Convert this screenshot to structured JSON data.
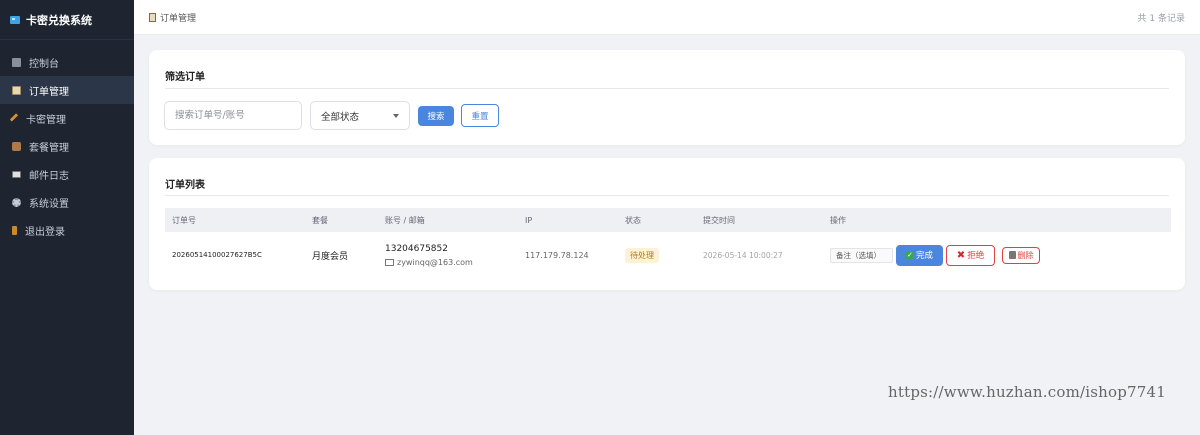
{
  "app": {
    "title": "卡密兑换系统"
  },
  "sidebar": {
    "items": [
      {
        "label": "控制台",
        "icon": "dashboard-icon"
      },
      {
        "label": "订单管理",
        "icon": "clipboard-icon",
        "active": true
      },
      {
        "label": "卡密管理",
        "icon": "key-icon"
      },
      {
        "label": "套餐管理",
        "icon": "package-icon"
      },
      {
        "label": "邮件日志",
        "icon": "mail-icon"
      },
      {
        "label": "系统设置",
        "icon": "gear-icon"
      },
      {
        "label": "退出登录",
        "icon": "exit-icon"
      }
    ]
  },
  "header": {
    "breadcrumb": "订单管理",
    "record_count": "共 1 条记录"
  },
  "filter": {
    "title": "筛选订单",
    "search_placeholder": "搜索订单号/账号",
    "status_selected": "全部状态",
    "search_label": "搜索",
    "reset_label": "重置"
  },
  "orders": {
    "title": "订单列表",
    "columns": [
      "订单号",
      "套餐",
      "账号 / 邮箱",
      "IP",
      "状态",
      "提交时间",
      "操作"
    ],
    "rows": [
      {
        "order_no": "20260514100027627B5C",
        "package": "月度会员",
        "phone": "13204675852",
        "email": "zywinqq@163.com",
        "ip": "117.179.78.124",
        "status": "待处理",
        "submit_time": "2026-05-14 10:00:27",
        "remark_placeholder": "备注（选填）",
        "done_label": "完成",
        "reject_label": "拒绝",
        "delete_label": "删除"
      }
    ]
  },
  "watermark": "https://www.huzhan.com/ishop7741",
  "colors": {
    "sidebar_bg": "#1e2430",
    "primary": "#4a86e0",
    "danger": "#e04040",
    "pending_badge": "#fdf1d8"
  }
}
